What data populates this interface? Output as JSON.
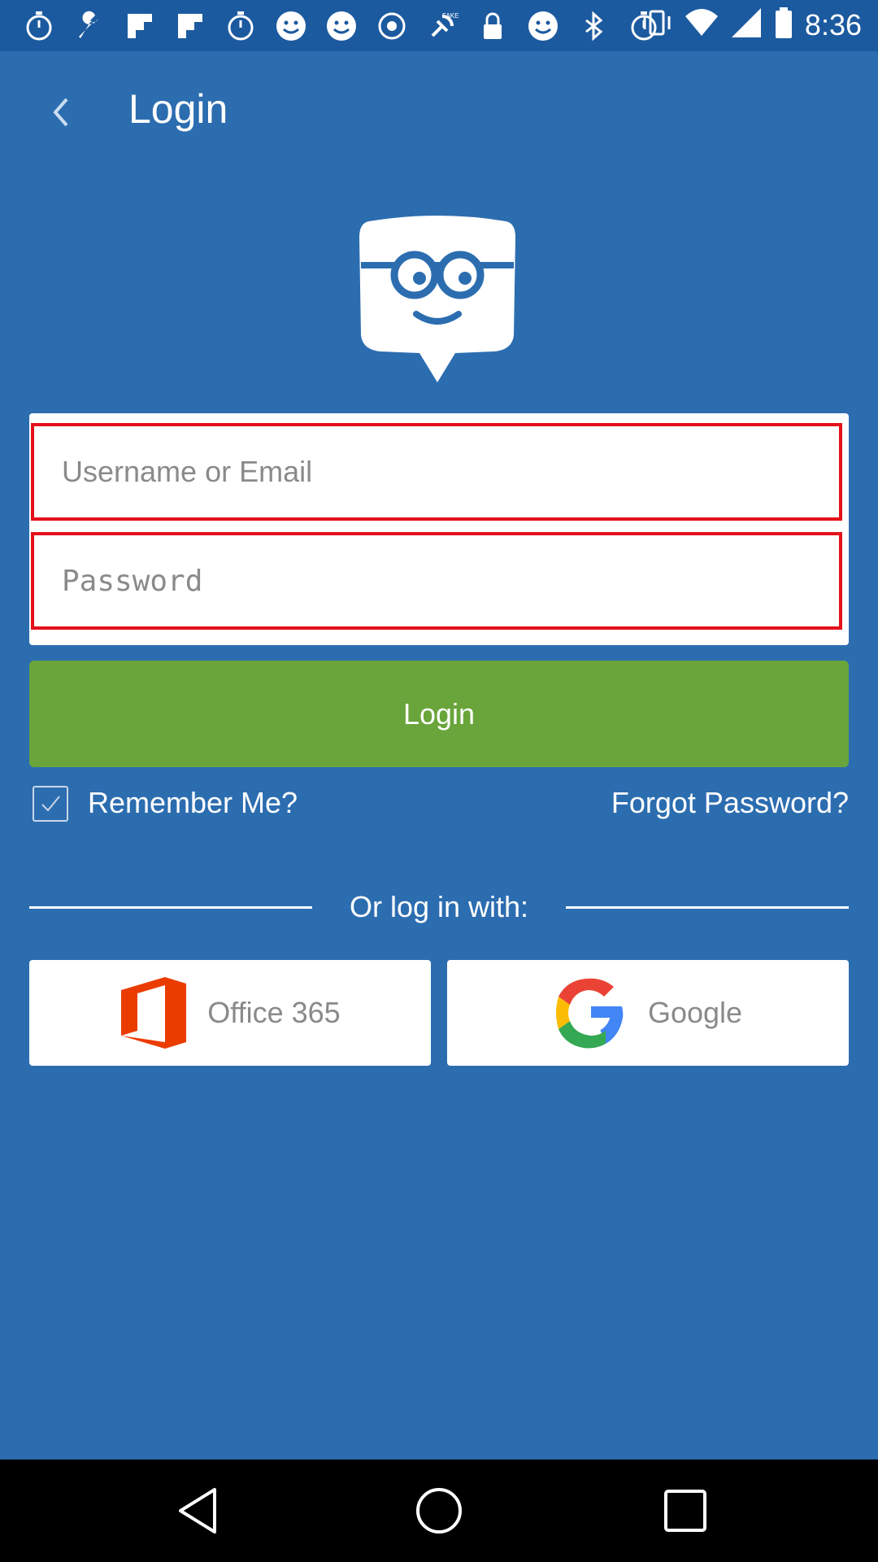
{
  "status_bar": {
    "time": "8:36",
    "icons": [
      "timer-icon",
      "wrench-icon",
      "flipboard-icon",
      "flipboard-icon",
      "timer-icon",
      "smiley-icon",
      "smiley-icon",
      "disc-icon",
      "fake-gps-icon",
      "lock-icon",
      "smiley-icon",
      "bluetooth-icon",
      "timer-icon",
      "vibrate-icon",
      "wifi-icon",
      "signal-icon",
      "battery-icon"
    ]
  },
  "header": {
    "title": "Login"
  },
  "form": {
    "username_placeholder": "Username or Email",
    "password_placeholder": "Password",
    "login_label": "Login",
    "remember_label": "Remember Me?",
    "remember_checked": true,
    "forgot_label": "Forgot Password?"
  },
  "divider": {
    "text": "Or log in with:"
  },
  "sso": {
    "office_label": "Office 365",
    "google_label": "Google"
  },
  "colors": {
    "background": "#2c6db0",
    "status_bar": "#1c5a9f",
    "login_button": "#69a53a",
    "field_border": "#e3111a",
    "office_red": "#eb3c00"
  }
}
